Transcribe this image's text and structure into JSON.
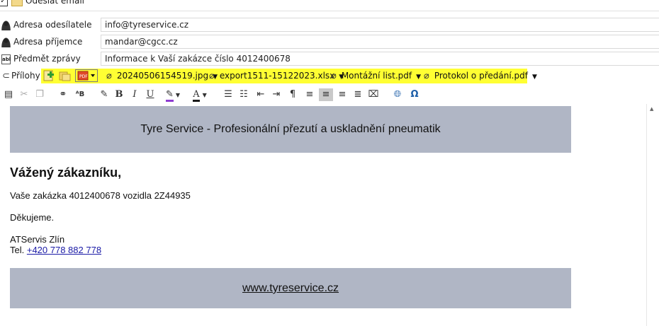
{
  "send_email": {
    "label": "Odeslat email",
    "checked": true
  },
  "fields": {
    "sender": {
      "label": "Adresa odesílatele",
      "value": "info@tyreservice.cz"
    },
    "recipient": {
      "label": "Adresa příjemce",
      "value": "mandar@cgcc.cz"
    },
    "subject": {
      "label": "Předmět zprávy",
      "value": "Informace k Vaší zakázce číslo 4012400678"
    }
  },
  "attachments": {
    "label": "Přílohy",
    "files": [
      {
        "name": "20240506154519.jpg"
      },
      {
        "name": "export1511-15122023.xlsx"
      },
      {
        "name": "Montážní list.pdf"
      },
      {
        "name": "Protokol o předání.pdf"
      }
    ],
    "highlight_color": "#ffff33"
  },
  "toolbar": {
    "icons": [
      "paste-icon",
      "cut-icon",
      "copy-icon",
      "find-icon",
      "spellcheck-icon",
      "format-painter-icon",
      "bold-icon",
      "italic-icon",
      "underline-icon",
      "highlight-icon",
      "font-color-icon",
      "bullets-icon",
      "numbering-icon",
      "outdent-icon",
      "indent-icon",
      "paragraph-icon",
      "align-left-icon",
      "align-center-icon",
      "align-right-icon",
      "justify-icon",
      "clear-format-icon",
      "hyperlink-icon",
      "omega-icon"
    ]
  },
  "email": {
    "banner_top": "Tyre Service - Profesionální přezutí a uskladnění pneumatik",
    "greeting": "Vážený zákazníku,",
    "order_line": "Vaše zakázka 4012400678 vozidla 2Z44935",
    "thanks": "Děkujeme.",
    "signature_name": "ATServis Zlín",
    "tel_label": "Tel.",
    "tel_number": "+420 778 882 778",
    "banner_bottom": "www.tyreservice.cz",
    "banner_color": "#b0b6c5"
  }
}
